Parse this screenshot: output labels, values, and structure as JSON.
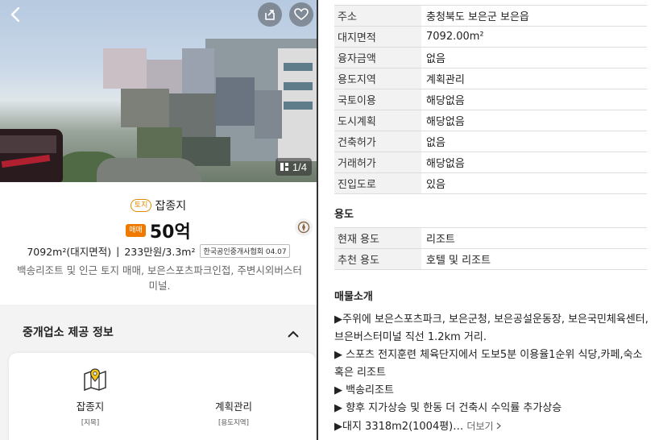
{
  "listing": {
    "photo_counter": "1/4",
    "land_tag": "토지",
    "type_name": "잡종지",
    "sale_tag": "매매",
    "price": "50억",
    "area": "7092m²(대지면적)",
    "separator": "|",
    "unit_price": "233만원/3.3m²",
    "association_badge": "한국공인중개사협회 04.07",
    "description": "백송리조트 및 인근 토지 매매, 보은스포츠파크인접, 주변시외버스터미널."
  },
  "broker": {
    "section_title": "중개업소 제공 정보",
    "cells": [
      {
        "main": "잡종지",
        "sub": "[지목]"
      },
      {
        "main": "계획관리",
        "sub": "[용도지역]"
      }
    ]
  },
  "details": [
    {
      "key": "주소",
      "value": "충청북도 보은군 보은읍"
    },
    {
      "key": "대지면적",
      "value": "7092.00m²"
    },
    {
      "key": "융자금액",
      "value": "없음"
    },
    {
      "key": "용도지역",
      "value": "계획관리"
    },
    {
      "key": "국토이용",
      "value": "해당없음"
    },
    {
      "key": "도시계획",
      "value": "해당없음"
    },
    {
      "key": "건축허가",
      "value": "없음"
    },
    {
      "key": "거래허가",
      "value": "해당없음"
    },
    {
      "key": "진입도로",
      "value": "있음"
    }
  ],
  "usage": {
    "title": "용도",
    "rows": [
      {
        "key": "현재 용도",
        "value": "리조트"
      },
      {
        "key": "추천 용도",
        "value": "호텔 및 리조트"
      }
    ]
  },
  "intro": {
    "title": "매물소개",
    "lines": [
      "▶주위에 보은스포츠파크, 보은군청, 보은공설운동장, 보은국민체육센터, 브은버스터미널 직선 1.2km 거리.",
      "▶ 스포츠 전지훈련 체육단지에서 도보5분 이용율1순위 식당,카페,숙소 혹은 리조트",
      "▶ 백송리조트",
      "▶ 향후 지가상승 및 한동 더 건축시 수익률 추가상승",
      "▶대지 3318m2(1004평)…"
    ],
    "more_label": "더보기"
  },
  "colors": {
    "accent": "#f07a00",
    "pin": "#f5c518",
    "table_key_bg": "#f2f2f2"
  },
  "icons": [
    "back-arrow-icon",
    "share-icon",
    "heart-icon",
    "gallery-icon",
    "compass-icon",
    "chevron-up-icon",
    "map-pin-icon",
    "chevron-right-icon"
  ]
}
